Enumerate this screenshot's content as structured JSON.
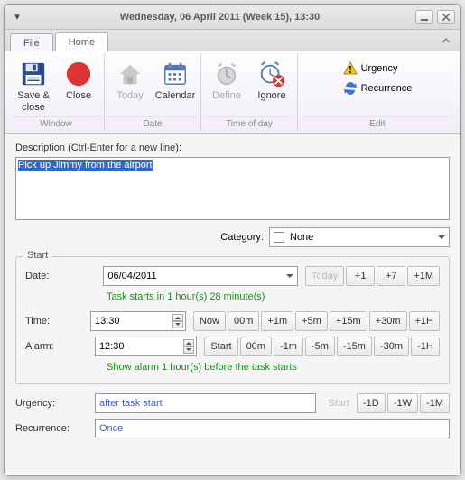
{
  "title": "Wednesday, 06 April 2011 (Week 15), 13:30",
  "tabs": {
    "file": "File",
    "home": "Home"
  },
  "ribbon": {
    "window": {
      "label": "Window",
      "save_close": "Save &\nclose",
      "close": "Close"
    },
    "date": {
      "label": "Date",
      "today": "Today",
      "calendar": "Calendar"
    },
    "time": {
      "label": "Time of day",
      "define": "Define",
      "ignore": "Ignore"
    },
    "edit": {
      "label": "Edit",
      "urgency": "Urgency",
      "recurrence": "Recurrence"
    }
  },
  "description": {
    "label": "Description (Ctrl-Enter for a new line):",
    "value": "Pick up Jimmy from the airport"
  },
  "category": {
    "label": "Category:",
    "value": "None"
  },
  "start": {
    "legend": "Start",
    "date_label": "Date:",
    "date_value": "06/04/2011",
    "date_hint": "Task starts in 1 hour(s) 28 minute(s)",
    "date_chips": {
      "today": "Today",
      "p1": "+1",
      "p7": "+7",
      "p1m": "+1M"
    },
    "time_label": "Time:",
    "time_value": "13:30",
    "time_chips": {
      "now": "Now",
      "z": "00m",
      "p1": "+1m",
      "p5": "+5m",
      "p15": "+15m",
      "p30": "+30m",
      "p1h": "+1H"
    },
    "alarm_label": "Alarm:",
    "alarm_value": "12:30",
    "alarm_hint": "Show alarm 1 hour(s) before the task starts",
    "alarm_chips": {
      "start": "Start",
      "z": "00m",
      "m1": "-1m",
      "m5": "-5m",
      "m15": "-15m",
      "m30": "-30m",
      "m1h": "-1H"
    }
  },
  "urgency": {
    "label": "Urgency:",
    "value": "after task start",
    "chips": {
      "start": "Start",
      "m1d": "-1D",
      "m1w": "-1W",
      "m1m": "-1M"
    }
  },
  "recurrence": {
    "label": "Recurrence:",
    "value": "Once"
  }
}
